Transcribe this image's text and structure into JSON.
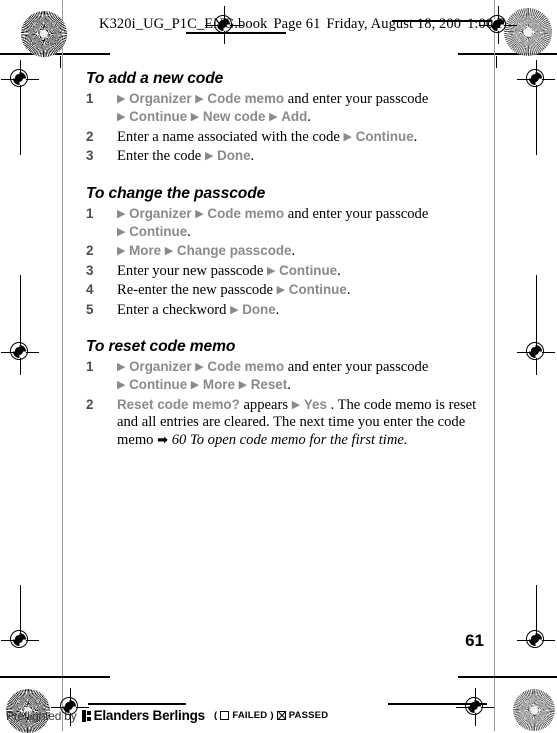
{
  "document": {
    "header_slug": "K320i_UG_P1C_ENG.book  Page 61  Friday, August 18, 200   1:00 P",
    "header_filename": "K320i_UG_P1C_ENG.book",
    "header_page": "Page 61",
    "header_date": "Friday, August 18, 200",
    "header_time": "1:00 P",
    "folio": "61"
  },
  "sections": [
    {
      "title": "To add a new code",
      "steps": [
        {
          "num": "1",
          "parts": [
            {
              "t": "arrow",
              "v": "▶"
            },
            {
              "t": "menu",
              "v": "Organizer"
            },
            {
              "t": "arrow",
              "v": "▶"
            },
            {
              "t": "menu",
              "v": "Code memo"
            },
            {
              "t": "plain",
              "v": "and enter your passcode"
            },
            {
              "t": "break",
              "v": ""
            },
            {
              "t": "arrow",
              "v": "▶"
            },
            {
              "t": "menu",
              "v": "Continue"
            },
            {
              "t": "arrow",
              "v": "▶"
            },
            {
              "t": "menu",
              "v": "New code"
            },
            {
              "t": "arrow",
              "v": "▶"
            },
            {
              "t": "menu",
              "v": "Add"
            },
            {
              "t": "plain",
              "v": "."
            }
          ]
        },
        {
          "num": "2",
          "parts": [
            {
              "t": "plain",
              "v": "Enter a name associated with the code"
            },
            {
              "t": "arrow",
              "v": "▶"
            },
            {
              "t": "menu",
              "v": "Continue"
            },
            {
              "t": "plain",
              "v": "."
            }
          ]
        },
        {
          "num": "3",
          "parts": [
            {
              "t": "plain",
              "v": "Enter the code"
            },
            {
              "t": "arrow",
              "v": "▶"
            },
            {
              "t": "menu",
              "v": "Done"
            },
            {
              "t": "plain",
              "v": "."
            }
          ]
        }
      ]
    },
    {
      "title": "To change the passcode",
      "steps": [
        {
          "num": "1",
          "parts": [
            {
              "t": "arrow",
              "v": "▶"
            },
            {
              "t": "menu",
              "v": "Organizer"
            },
            {
              "t": "arrow",
              "v": "▶"
            },
            {
              "t": "menu",
              "v": "Code memo"
            },
            {
              "t": "plain",
              "v": "and enter your passcode"
            },
            {
              "t": "break",
              "v": ""
            },
            {
              "t": "arrow",
              "v": "▶"
            },
            {
              "t": "menu",
              "v": "Continue"
            },
            {
              "t": "plain",
              "v": "."
            }
          ]
        },
        {
          "num": "2",
          "parts": [
            {
              "t": "arrow",
              "v": "▶"
            },
            {
              "t": "menu",
              "v": "More"
            },
            {
              "t": "arrow",
              "v": "▶"
            },
            {
              "t": "menu",
              "v": "Change passcode"
            },
            {
              "t": "plain",
              "v": "."
            }
          ]
        },
        {
          "num": "3",
          "parts": [
            {
              "t": "plain",
              "v": "Enter your new passcode"
            },
            {
              "t": "arrow",
              "v": "▶"
            },
            {
              "t": "menu",
              "v": "Continue"
            },
            {
              "t": "plain",
              "v": "."
            }
          ]
        },
        {
          "num": "4",
          "parts": [
            {
              "t": "plain",
              "v": "Re-enter the new passcode"
            },
            {
              "t": "arrow",
              "v": "▶"
            },
            {
              "t": "menu",
              "v": "Continue"
            },
            {
              "t": "plain",
              "v": "."
            }
          ]
        },
        {
          "num": "5",
          "parts": [
            {
              "t": "plain",
              "v": "Enter a checkword"
            },
            {
              "t": "arrow",
              "v": "▶"
            },
            {
              "t": "menu",
              "v": "Done"
            },
            {
              "t": "plain",
              "v": "."
            }
          ]
        }
      ]
    },
    {
      "title": "To reset code memo",
      "steps": [
        {
          "num": "1",
          "parts": [
            {
              "t": "arrow",
              "v": "▶"
            },
            {
              "t": "menu",
              "v": "Organizer"
            },
            {
              "t": "arrow",
              "v": "▶"
            },
            {
              "t": "menu",
              "v": "Code memo"
            },
            {
              "t": "plain",
              "v": "and enter your passcode"
            },
            {
              "t": "break",
              "v": ""
            },
            {
              "t": "arrow",
              "v": "▶"
            },
            {
              "t": "menu",
              "v": "Continue"
            },
            {
              "t": "arrow",
              "v": "▶"
            },
            {
              "t": "menu",
              "v": "More"
            },
            {
              "t": "arrow",
              "v": "▶"
            },
            {
              "t": "menu",
              "v": "Reset"
            },
            {
              "t": "plain",
              "v": "."
            }
          ]
        },
        {
          "num": "2",
          "parts": [
            {
              "t": "menu",
              "v": "Reset code memo?"
            },
            {
              "t": "plain",
              "v": "appears"
            },
            {
              "t": "arrow",
              "v": "▶"
            },
            {
              "t": "menu",
              "v": "Yes"
            },
            {
              "t": "plain",
              "v": ". The code memo is reset and all entries are cleared. The next time you enter the code memo"
            },
            {
              "t": "blackarrow",
              "v": "➡"
            },
            {
              "t": "italic",
              "v": "60 To open code memo for the first time."
            }
          ]
        }
      ]
    }
  ],
  "preflight": {
    "prefix": "Preflighted by",
    "brand": "Elanders Berlings",
    "open_paren": "(",
    "failed_label": "FAILED",
    "close_paren": ")",
    "passed_label": "PASSED"
  },
  "colors": {
    "menu_gray": "#8a8a8a",
    "step_num_gray": "#4d4d4d",
    "text_black": "#000000",
    "guide_gray": "#9a9a9a"
  }
}
